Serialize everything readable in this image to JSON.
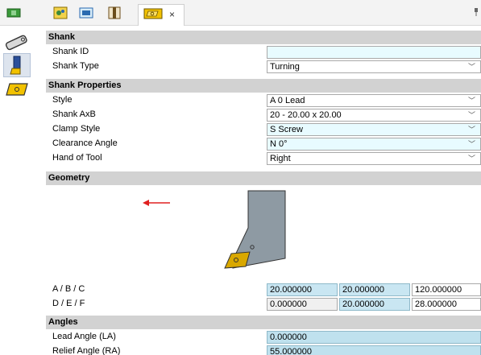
{
  "toolbar": {
    "buttons": [
      "insert-icon",
      "gears-icon",
      "image-icon",
      "columns-icon"
    ],
    "active_tab_close": "×",
    "pin": "📌"
  },
  "strip": {
    "items": [
      "holder-icon",
      "shank-icon",
      "insert-icon"
    ]
  },
  "shank": {
    "header": "Shank",
    "id_label": "Shank ID",
    "id_value": "",
    "type_label": "Shank Type",
    "type_value": "Turning"
  },
  "shank_props": {
    "header": "Shank Properties",
    "style_label": "Style",
    "style_value": "A 0 Lead",
    "axb_label": "Shank AxB",
    "axb_value": "20 - 20.00 x 20.00",
    "clamp_label": "Clamp Style",
    "clamp_value": "S Screw",
    "clearance_label": "Clearance Angle",
    "clearance_value": "N  0°",
    "hand_label": "Hand of Tool",
    "hand_value": "Right"
  },
  "geometry": {
    "header": "Geometry",
    "abc_label": "A / B / C",
    "abc_values": [
      "20.000000",
      "20.000000",
      "120.000000"
    ],
    "def_label": "D / E / F",
    "def_values": [
      "0.000000",
      "20.000000",
      "28.000000"
    ]
  },
  "angles": {
    "header": "Angles",
    "lead_label": "Lead Angle (LA)",
    "lead_value": "0.000000",
    "relief_label": "Relief Angle (RA)",
    "relief_value": "55.000000"
  },
  "colors": {
    "header_bg": "#d2d2d2",
    "shank_fill": "#8e9aa3",
    "insert_fill": "#d9a800",
    "arrow": "#e02020",
    "value_blue": "#bfe1ee"
  }
}
